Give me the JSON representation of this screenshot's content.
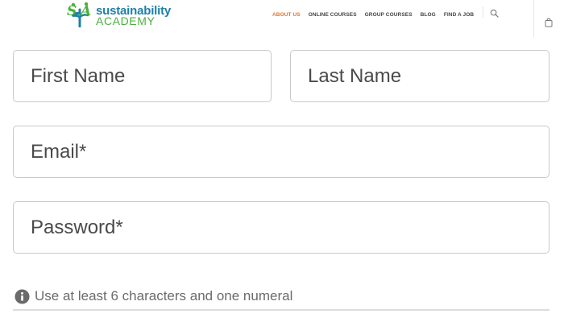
{
  "header": {
    "logo": {
      "mark": "SA",
      "line1": "sustainability",
      "line2": "ACADEMY"
    },
    "nav": [
      {
        "label": "ABOUT US",
        "active": true
      },
      {
        "label": "ONLINE COURSES",
        "active": false
      },
      {
        "label": "GROUP COURSES",
        "active": false
      },
      {
        "label": "BLOG",
        "active": false
      },
      {
        "label": "FIND A JOB",
        "active": false
      }
    ],
    "icons": {
      "search": "search-icon",
      "cart": "shopping-bag-icon"
    }
  },
  "form": {
    "first_name": {
      "placeholder": "First Name",
      "value": ""
    },
    "last_name": {
      "placeholder": "Last Name",
      "value": ""
    },
    "email": {
      "placeholder": "Email*",
      "value": ""
    },
    "password": {
      "placeholder": "Password*",
      "value": ""
    },
    "hint": "Use at least 6 characters and one numeral"
  },
  "colors": {
    "accent_active": "#e0722e",
    "brand_blue": "#1f7fa8",
    "brand_green": "#4caf3e",
    "field_border": "#c9c9c9"
  }
}
